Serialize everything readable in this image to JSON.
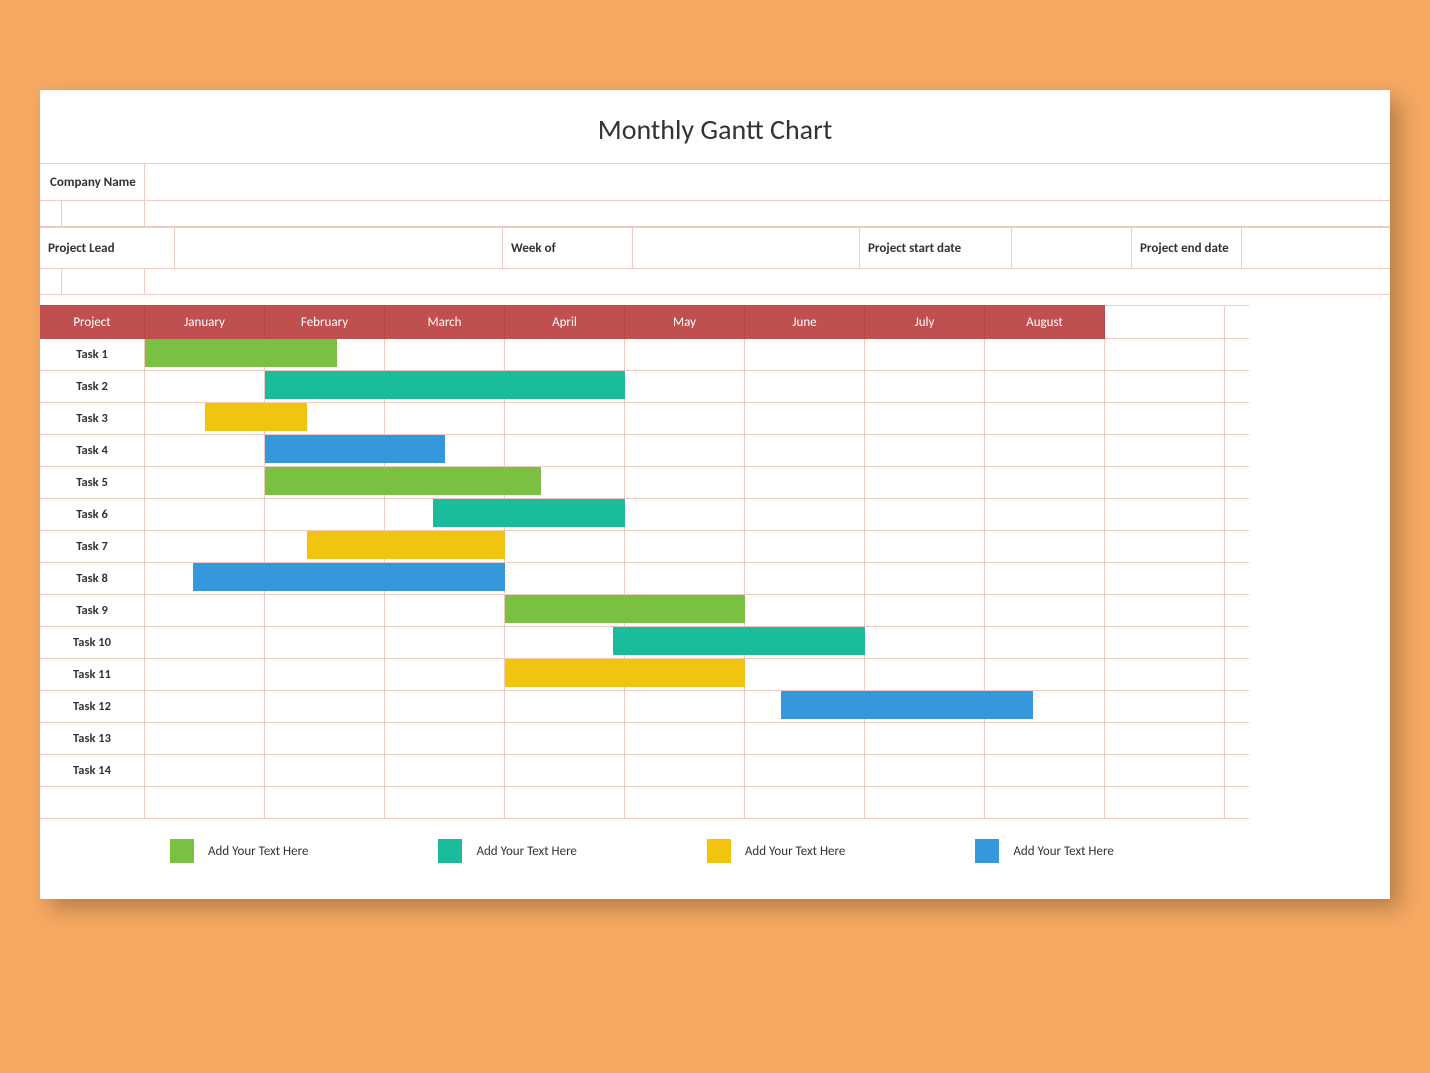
{
  "title": "Monthly Gantt Chart",
  "header": {
    "company_label": "Company Name",
    "project_lead_label": "Project Lead",
    "week_of_label": "Week of",
    "project_start_label": "Project start date",
    "project_end_label": "Project end date"
  },
  "months_header_label": "Project",
  "months": [
    "January",
    "February",
    "March",
    "April",
    "May",
    "June",
    "July",
    "August"
  ],
  "tasks": [
    {
      "name": "Task 1",
      "color": "green",
      "start": 0.0,
      "duration": 1.6
    },
    {
      "name": "Task 2",
      "color": "teal",
      "start": 1.0,
      "duration": 3.0
    },
    {
      "name": "Task 3",
      "color": "yellow",
      "start": 0.5,
      "duration": 0.85
    },
    {
      "name": "Task 4",
      "color": "blue",
      "start": 1.0,
      "duration": 1.5
    },
    {
      "name": "Task 5",
      "color": "green",
      "start": 1.0,
      "duration": 2.3
    },
    {
      "name": "Task 6",
      "color": "teal",
      "start": 2.4,
      "duration": 1.6
    },
    {
      "name": "Task 7",
      "color": "yellow",
      "start": 1.35,
      "duration": 1.65
    },
    {
      "name": "Task 8",
      "color": "blue",
      "start": 0.4,
      "duration": 2.6
    },
    {
      "name": "Task 9",
      "color": "green",
      "start": 3.0,
      "duration": 2.0
    },
    {
      "name": "Task 10",
      "color": "teal",
      "start": 3.9,
      "duration": 2.1
    },
    {
      "name": "Task 11",
      "color": "yellow",
      "start": 3.0,
      "duration": 2.0
    },
    {
      "name": "Task 12",
      "color": "blue",
      "start": 5.3,
      "duration": 2.1
    },
    {
      "name": "Task 13",
      "color": null,
      "start": null,
      "duration": null
    },
    {
      "name": "Task 14",
      "color": null,
      "start": null,
      "duration": null
    }
  ],
  "legend": [
    {
      "color": "green",
      "label": "Add Your Text Here"
    },
    {
      "color": "teal",
      "label": "Add Your Text Here"
    },
    {
      "color": "yellow",
      "label": "Add Your Text Here"
    },
    {
      "color": "blue",
      "label": "Add Your Text Here"
    }
  ],
  "colors": {
    "green": "#7ac143",
    "teal": "#1abc9c",
    "yellow": "#f1c40f",
    "blue": "#3498db",
    "header_red": "#c04f4f",
    "grid": "#f3c9c6",
    "page_bg": "#f5a962"
  },
  "chart_data": {
    "type": "gantt",
    "title": "Monthly Gantt Chart",
    "categories": [
      "January",
      "February",
      "March",
      "April",
      "May",
      "June",
      "July",
      "August"
    ],
    "x_unit": "month-index (0 = start of January)",
    "series": [
      {
        "name": "Task 1",
        "category": "green",
        "start": 0.0,
        "end": 1.6
      },
      {
        "name": "Task 2",
        "category": "teal",
        "start": 1.0,
        "end": 4.0
      },
      {
        "name": "Task 3",
        "category": "yellow",
        "start": 0.5,
        "end": 1.35
      },
      {
        "name": "Task 4",
        "category": "blue",
        "start": 1.0,
        "end": 2.5
      },
      {
        "name": "Task 5",
        "category": "green",
        "start": 1.0,
        "end": 3.3
      },
      {
        "name": "Task 6",
        "category": "teal",
        "start": 2.4,
        "end": 4.0
      },
      {
        "name": "Task 7",
        "category": "yellow",
        "start": 1.35,
        "end": 3.0
      },
      {
        "name": "Task 8",
        "category": "blue",
        "start": 0.4,
        "end": 3.0
      },
      {
        "name": "Task 9",
        "category": "green",
        "start": 3.0,
        "end": 5.0
      },
      {
        "name": "Task 10",
        "category": "teal",
        "start": 3.9,
        "end": 6.0
      },
      {
        "name": "Task 11",
        "category": "yellow",
        "start": 3.0,
        "end": 5.0
      },
      {
        "name": "Task 12",
        "category": "blue",
        "start": 5.3,
        "end": 7.4
      },
      {
        "name": "Task 13",
        "category": null,
        "start": null,
        "end": null
      },
      {
        "name": "Task 14",
        "category": null,
        "start": null,
        "end": null
      }
    ],
    "legend_position": "bottom",
    "xlim": [
      0,
      8
    ]
  }
}
